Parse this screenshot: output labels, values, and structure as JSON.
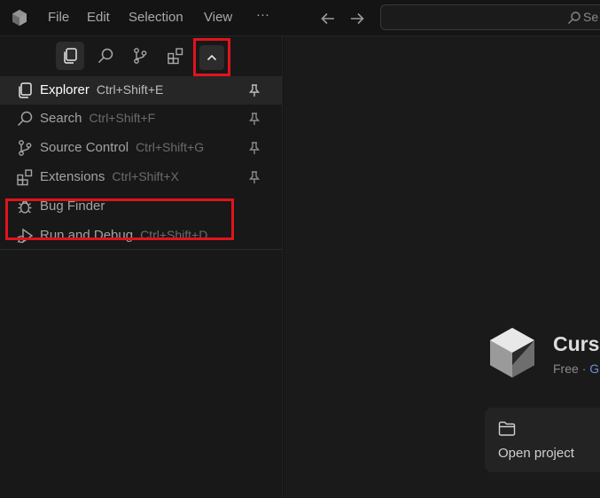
{
  "titlebar": {
    "menu": [
      "File",
      "Edit",
      "Selection",
      "View",
      "···"
    ],
    "search_text": "Se"
  },
  "activity_icons": [
    "explorer-icon",
    "search-icon",
    "source-control-icon",
    "extensions-icon",
    "chevron-up-icon"
  ],
  "views": [
    {
      "label": "Explorer",
      "shortcut": "Ctrl+Shift+E",
      "icon": "files-icon",
      "pinned": true,
      "selected": true
    },
    {
      "label": "Search",
      "shortcut": "Ctrl+Shift+F",
      "icon": "search-icon",
      "pinned": true
    },
    {
      "label": "Source Control",
      "shortcut": "Ctrl+Shift+G",
      "icon": "source-control-icon",
      "pinned": true
    },
    {
      "label": "Extensions",
      "shortcut": "Ctrl+Shift+X",
      "icon": "extensions-icon",
      "pinned": true
    },
    {
      "label": "Bug Finder",
      "shortcut": "",
      "icon": "bug-icon",
      "pinned": false
    },
    {
      "label": "Run and Debug",
      "shortcut": "Ctrl+Shift+D",
      "icon": "debug-icon",
      "pinned": false
    }
  ],
  "welcome": {
    "brand": "Curso",
    "plan": "Free",
    "plan_sep": "·",
    "plan_link": "G",
    "open_project": "Open project"
  },
  "colors": {
    "highlight": "#e0141c",
    "link": "#6f8fd6"
  }
}
